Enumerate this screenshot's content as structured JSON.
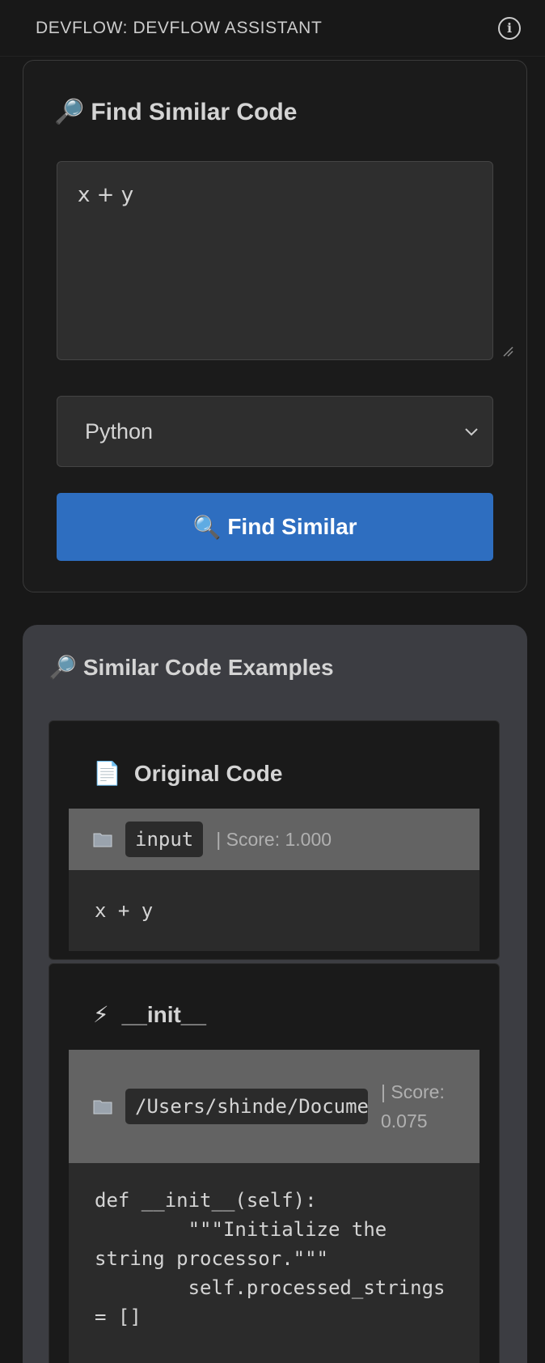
{
  "header": {
    "title": "DEVFLOW: DEVFLOW ASSISTANT",
    "info_icon": "info-icon"
  },
  "find_panel": {
    "title": "Find Similar Code",
    "title_icon": "🔎",
    "code_value": "x + y",
    "language": "Python",
    "button_icon": "🔍",
    "button_label": "Find Similar"
  },
  "results": {
    "title": "Similar Code Examples",
    "title_icon": "🔎",
    "items": [
      {
        "icon": "📄",
        "title": "Original Code",
        "source": "input",
        "score": "| Score: 1.000",
        "code": "x + y"
      },
      {
        "icon": "⚡",
        "title": "__init__",
        "source": "/Users/shinde/Documents",
        "score": "| Score: 0.075",
        "code": "def __init__(self):\n        \"\"\"Initialize the string processor.\"\"\"\n        self.processed_strings = []"
      }
    ]
  },
  "colors": {
    "accent_button": "#2e6ec0",
    "panel_bg": "#1b1b1b",
    "results_bg": "#3c3d42",
    "meta_bar": "#636363"
  }
}
